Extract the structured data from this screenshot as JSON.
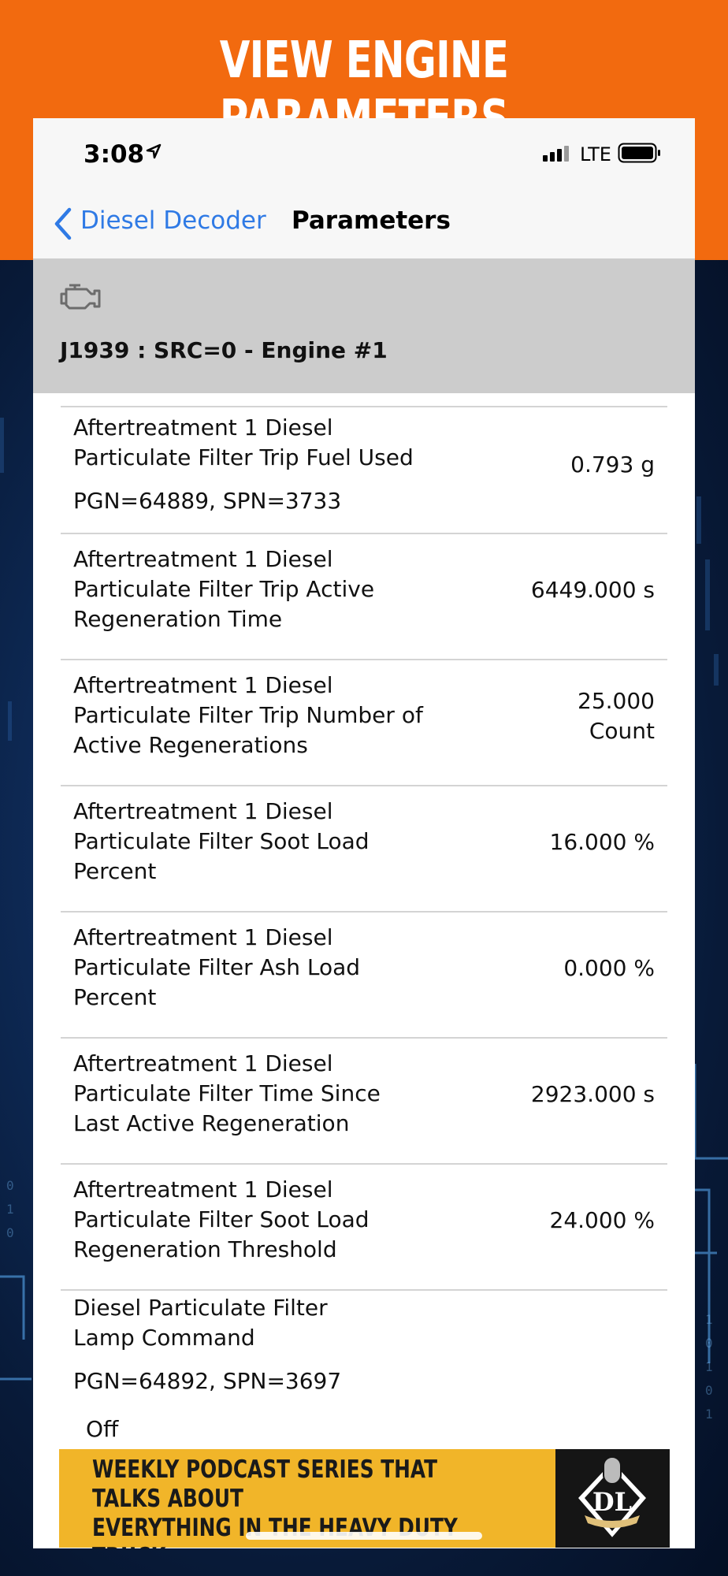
{
  "promo": {
    "title": "VIEW ENGINE PARAMETERS"
  },
  "status_bar": {
    "time": "3:08",
    "network": "LTE"
  },
  "navbar": {
    "back_label": "Diesel Decoder",
    "title": "Parameters"
  },
  "section": {
    "header": "J1939 : SRC=0 - Engine #1",
    "icon": "engine-icon"
  },
  "rows": [
    {
      "label": "Aftertreatment 1 Diesel\nParticulate Filter Trip Fuel Used",
      "sub": "PGN=64889, SPN=3733",
      "value": "0.793 g"
    },
    {
      "label": "Aftertreatment 1 Diesel\nParticulate Filter Trip Active\nRegeneration Time",
      "sub": "",
      "value": "6449.000 s"
    },
    {
      "label": "Aftertreatment 1 Diesel\nParticulate Filter Trip Number of\nActive Regenerations",
      "sub": "",
      "value": "25.000\nCount"
    },
    {
      "label": "Aftertreatment 1 Diesel\nParticulate Filter Soot Load\nPercent",
      "sub": "",
      "value": "16.000 %"
    },
    {
      "label": "Aftertreatment 1 Diesel\nParticulate Filter Ash Load\nPercent",
      "sub": "",
      "value": "0.000 %"
    },
    {
      "label": "Aftertreatment 1 Diesel\nParticulate Filter Time Since\nLast Active Regeneration",
      "sub": "",
      "value": "2923.000 s"
    },
    {
      "label": "Aftertreatment 1 Diesel\nParticulate Filter Soot Load\nRegeneration Threshold",
      "sub": "",
      "value": "24.000 %"
    },
    {
      "label": "Diesel Particulate Filter\nLamp Command",
      "sub": "PGN=64892, SPN=3697",
      "value": "",
      "extra": "Off"
    }
  ],
  "ad": {
    "text": "WEEKLY PODCAST SERIES THAT TALKS ABOUT\nEVERYTHING IN THE HEAVY DUTY TRUCK\nINDUSTRY WITH HOST, TYLER ROBERTSON.",
    "logo_text": "DL"
  },
  "colors": {
    "orange": "#f26a0f",
    "ios_blue": "#2f7ae5",
    "ad_yellow": "#f1b529",
    "header_gray": "#cccccc"
  }
}
